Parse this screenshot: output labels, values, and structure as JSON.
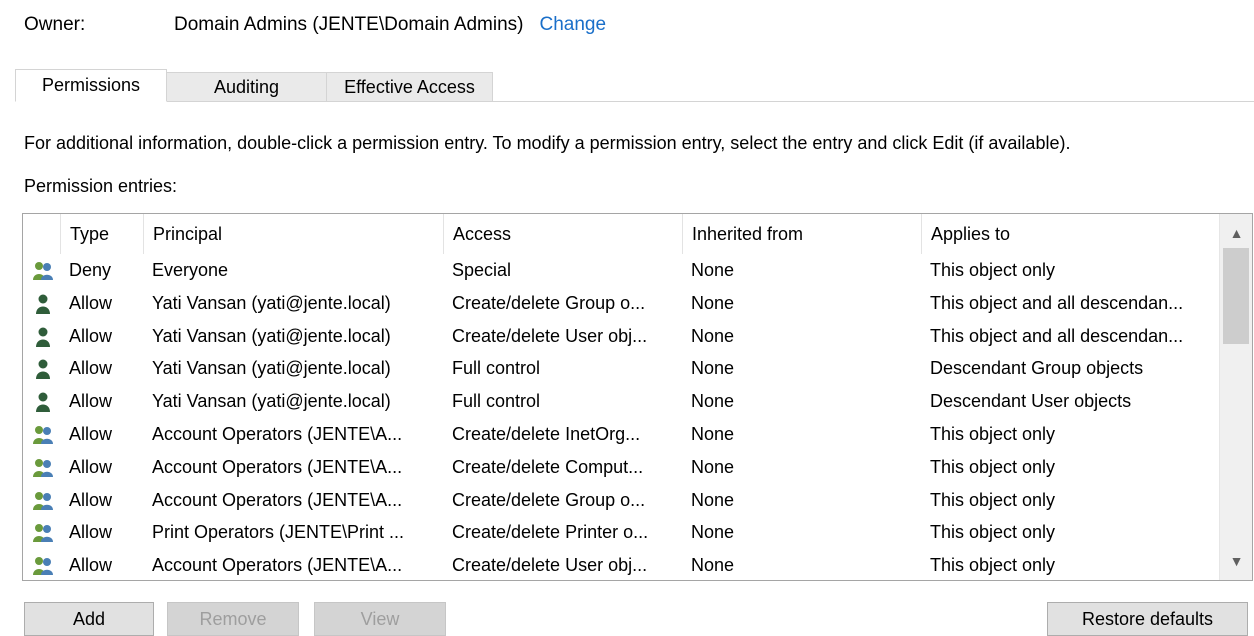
{
  "owner": {
    "label": "Owner:",
    "value": "Domain Admins (JENTE\\Domain Admins)",
    "change_link": "Change"
  },
  "tabs": [
    {
      "label": "Permissions",
      "active": true
    },
    {
      "label": "Auditing",
      "active": false
    },
    {
      "label": "Effective Access",
      "active": false
    }
  ],
  "info_text": "For additional information, double-click a permission entry. To modify a permission entry, select the entry and click Edit (if available).",
  "entries_label": "Permission entries:",
  "columns": {
    "type": "Type",
    "principal": "Principal",
    "access": "Access",
    "inherited": "Inherited from",
    "applies": "Applies to"
  },
  "rows": [
    {
      "icon": "group-icon",
      "type": "Deny",
      "principal": "Everyone",
      "access": "Special",
      "inherited": "None",
      "applies": "This object only"
    },
    {
      "icon": "user-icon",
      "type": "Allow",
      "principal": "Yati Vansan (yati@jente.local)",
      "access": "Create/delete Group o...",
      "inherited": "None",
      "applies": "This object and all descendan..."
    },
    {
      "icon": "user-icon",
      "type": "Allow",
      "principal": "Yati Vansan (yati@jente.local)",
      "access": "Create/delete User obj...",
      "inherited": "None",
      "applies": "This object and all descendan..."
    },
    {
      "icon": "user-icon",
      "type": "Allow",
      "principal": "Yati Vansan (yati@jente.local)",
      "access": "Full control",
      "inherited": "None",
      "applies": "Descendant Group objects"
    },
    {
      "icon": "user-icon",
      "type": "Allow",
      "principal": "Yati Vansan (yati@jente.local)",
      "access": "Full control",
      "inherited": "None",
      "applies": "Descendant User objects"
    },
    {
      "icon": "group-icon",
      "type": "Allow",
      "principal": "Account Operators (JENTE\\A...",
      "access": "Create/delete InetOrg...",
      "inherited": "None",
      "applies": "This object only"
    },
    {
      "icon": "group-icon",
      "type": "Allow",
      "principal": "Account Operators (JENTE\\A...",
      "access": "Create/delete Comput...",
      "inherited": "None",
      "applies": "This object only"
    },
    {
      "icon": "group-icon",
      "type": "Allow",
      "principal": "Account Operators (JENTE\\A...",
      "access": "Create/delete Group o...",
      "inherited": "None",
      "applies": "This object only"
    },
    {
      "icon": "group-icon",
      "type": "Allow",
      "principal": "Print Operators (JENTE\\Print ...",
      "access": "Create/delete Printer o...",
      "inherited": "None",
      "applies": "This object only"
    },
    {
      "icon": "group-icon",
      "type": "Allow",
      "principal": "Account Operators (JENTE\\A...",
      "access": "Create/delete User obj...",
      "inherited": "None",
      "applies": "This object only"
    }
  ],
  "buttons": {
    "add": "Add",
    "remove": "Remove",
    "view": "View",
    "restore": "Restore defaults"
  },
  "colors": {
    "link": "#1a6fc9",
    "group_icon_green": "#6a9a3c",
    "user_icon_dark": "#2f5d3a"
  }
}
